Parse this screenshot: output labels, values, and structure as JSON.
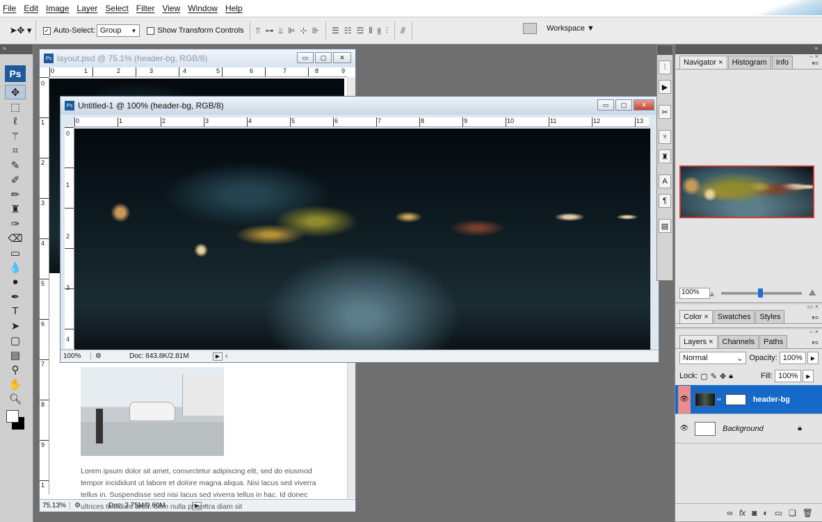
{
  "menu": [
    "File",
    "Edit",
    "Image",
    "Layer",
    "Select",
    "Filter",
    "View",
    "Window",
    "Help"
  ],
  "options": {
    "auto_select_label": "Auto-Select:",
    "auto_select_value": "Group",
    "show_transform_label": "Show Transform Controls",
    "workspace_label": "Workspace ▼"
  },
  "toolbox": {
    "logo": "Ps",
    "tools": [
      "move-tool",
      "marquee-tool",
      "lasso-tool",
      "magic-wand-tool",
      "crop-tool",
      "eyedropper-tool",
      "healing-brush-tool",
      "brush-tool",
      "clone-stamp-tool",
      "history-brush-tool",
      "eraser-tool",
      "gradient-tool",
      "blur-tool",
      "dodge-tool",
      "pen-tool",
      "type-tool",
      "path-selection-tool",
      "shape-tool",
      "notes-tool",
      "eyedropper-tool-2",
      "hand-tool",
      "zoom-tool"
    ]
  },
  "doc1": {
    "title": "layout.psd @ 75.1% (header-bg, RGB/8)",
    "zoom": "75.13%",
    "docinfo": "Doc: 2.75M/9.60M",
    "ruler_top": [
      "0",
      "1",
      "2",
      "3",
      "4",
      "5",
      "6",
      "7",
      "8",
      "9"
    ],
    "ruler_left": [
      "0",
      "1",
      "2",
      "3",
      "4",
      "5",
      "6",
      "7",
      "8",
      "9",
      "1"
    ],
    "lorem": "Lorem ipsum dolor sit amet, consectetur adipiscing elit, sed do eiusmod tempor incididunt ut labore et dolore magna aliqua. Nisi lacus sed viverra tellus in. Suspendisse sed nisi lacus sed viverra tellus in hac. Id donec ultrices tincidunt arcu. Sem nulla pharetra diam sit"
  },
  "doc2": {
    "title": "Untitled-1 @ 100% (header-bg, RGB/8)",
    "zoom": "100%",
    "docinfo": "Doc: 843.8K/2.81M",
    "ruler_top": [
      "0",
      "1",
      "2",
      "3",
      "4",
      "5",
      "6",
      "7",
      "8",
      "9",
      "10",
      "11",
      "12",
      "13"
    ],
    "ruler_left": [
      "0",
      "1",
      "2",
      "3",
      "4"
    ]
  },
  "navigator": {
    "tabs": [
      "Navigator ×",
      "Histogram",
      "Info"
    ],
    "zoom": "100%"
  },
  "color_panel": {
    "tabs": [
      "Color ×",
      "Swatches",
      "Styles"
    ]
  },
  "layers": {
    "tabs": [
      "Layers ×",
      "Channels",
      "Paths"
    ],
    "blend_mode": "Normal",
    "opacity_label": "Opacity:",
    "opacity": "100%",
    "lock_label": "Lock:",
    "fill_label": "Fill:",
    "fill": "100%",
    "items": [
      {
        "name": "header-bg"
      },
      {
        "name": "Background"
      }
    ]
  }
}
